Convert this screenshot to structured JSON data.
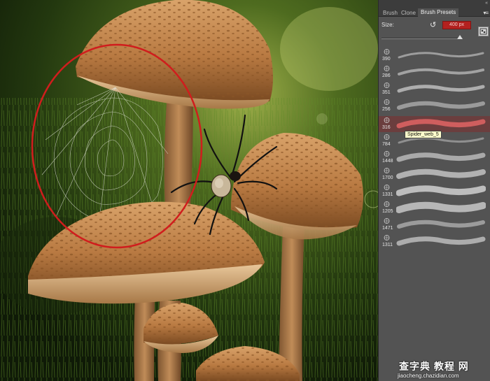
{
  "panel": {
    "tabs": [
      "Brush",
      "Clone",
      "Brush Presets"
    ],
    "size_label": "Size:",
    "size_value": "400 px",
    "menu_icon": "panel-menu-icon",
    "reset_icon": "reset-arrow-icon",
    "presets": [
      {
        "size": "390"
      },
      {
        "size": "286"
      },
      {
        "size": "351"
      },
      {
        "size": "256"
      },
      {
        "size": "316",
        "selected": true
      },
      {
        "size": "784"
      },
      {
        "size": "1448"
      },
      {
        "size": "1700"
      },
      {
        "size": "1331"
      },
      {
        "size": "1205"
      },
      {
        "size": "1471"
      },
      {
        "size": "1311"
      }
    ],
    "tooltip": "Spider_web_5"
  },
  "watermark": {
    "main": "查字典 教程 网",
    "url": "jiaocheng.chazidian.com"
  },
  "colors": {
    "panel_bg": "#535353",
    "size_field": "#b3211f",
    "annotation_circle": "#d01d1d"
  }
}
